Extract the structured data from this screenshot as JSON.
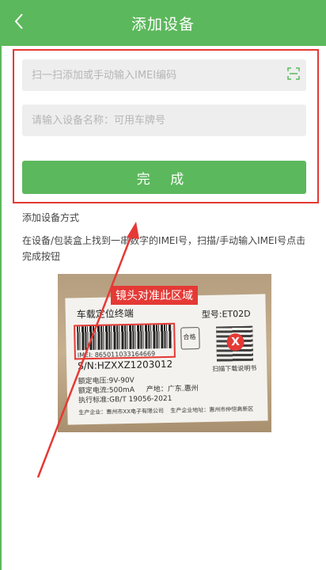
{
  "header": {
    "title": "添加设备"
  },
  "form": {
    "imei_placeholder": "扫一扫添加或手动输入IMEI编码",
    "name_placeholder": "请输入设备名称：可用车牌号",
    "done_label": "完 成"
  },
  "method": {
    "title": "添加设备方式",
    "desc": "在设备/包装盒上找到一串数字的IMEI号，扫描/手动输入IMEI号点击完成按钮"
  },
  "photo": {
    "callout": "镜头对准此区域",
    "label_title": "车载定位终端",
    "model": "型号:ET02D",
    "imei": "IMEI: 865011033164669",
    "sn": "S/N:HZXXZ1203012",
    "spec_voltage": "额定电压:9V-90V",
    "spec_current": "额定电流:500mA",
    "spec_standard": "执行标准:GB/T 19056-2021",
    "origin": "产地：广东.惠州",
    "maker_left": "生产企业：惠州市XX电子有限公司",
    "maker_right": "生产企业地址：惠州市仲恺高新区",
    "cert": "合格",
    "qr_badge": "X",
    "qr_caption": "扫描下载说明书"
  },
  "colors": {
    "accent": "#5cb85c",
    "highlight": "#e53935"
  },
  "icons": {
    "back": "chevron-left-icon",
    "scan": "scan-icon"
  }
}
